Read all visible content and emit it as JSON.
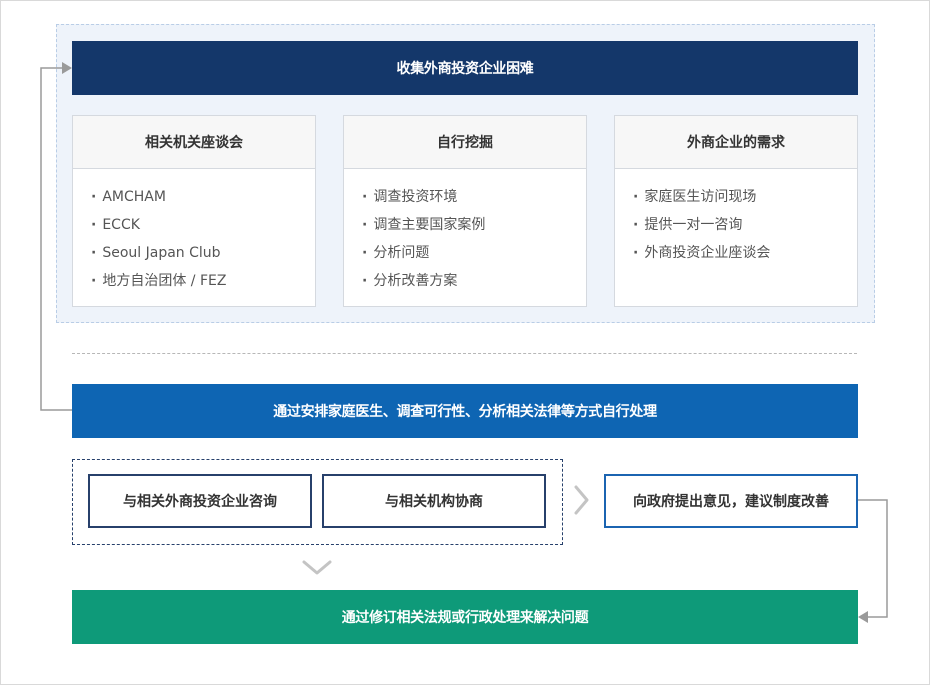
{
  "top_bar": {
    "label": "收集外商投资企业困难"
  },
  "cards": [
    {
      "title": "相关机关座谈会",
      "items": [
        "AMCHAM",
        "ECCK",
        "Seoul Japan Club",
        "地方自治团体 / FEZ"
      ]
    },
    {
      "title": "自行挖掘",
      "items": [
        "调查投资环境",
        "调查主要国家案例",
        "分析问题",
        "分析改善方案"
      ]
    },
    {
      "title": "外商企业的需求",
      "items": [
        "家庭医生访问现场",
        "提供一对一咨询",
        "外商投资企业座谈会"
      ]
    }
  ],
  "process_bar": {
    "label": "通过安排家庭医生、调查可行性、分析相关法律等方式自行处理"
  },
  "consult_boxes": {
    "box1": "与相关外商投资企业咨询",
    "box2": "与相关机构协商"
  },
  "proposal_box": {
    "label": "向政府提出意见，建议制度改善"
  },
  "result_bar": {
    "label": "通过修订相关法规或行政处理来解决问题"
  },
  "colors": {
    "navy": "#14376a",
    "blue": "#0e65b3",
    "green": "#0e9a79",
    "zone_bg": "#eef3fa"
  }
}
